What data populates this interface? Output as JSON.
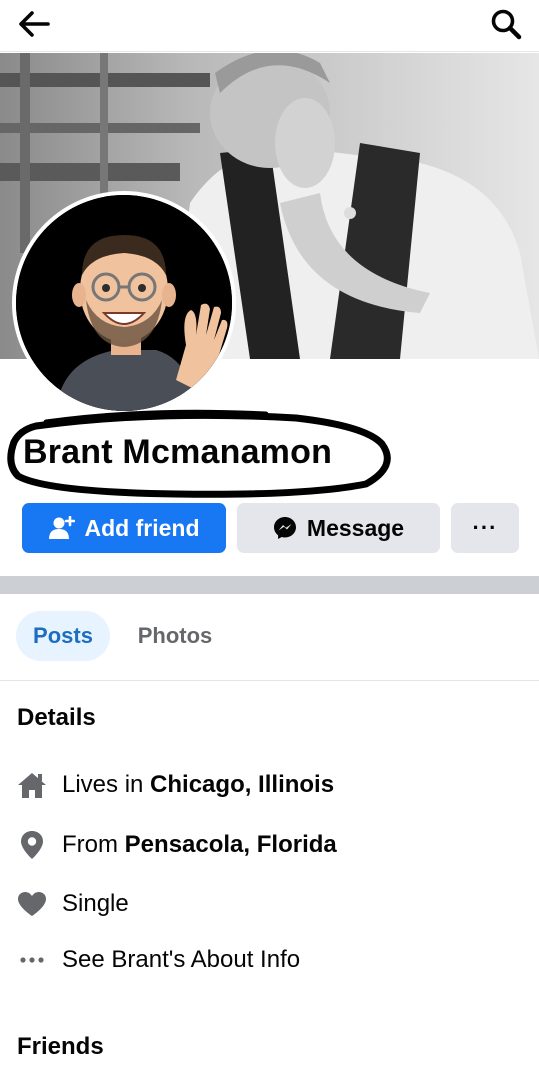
{
  "header": {
    "back_icon": "arrow-left-icon",
    "search_icon": "search-icon"
  },
  "profile": {
    "name": "Brant Mcmanamon",
    "cover_photo": "cover-photo",
    "avatar": "avatar-image"
  },
  "actions": {
    "add_friend_label": "Add friend",
    "message_label": "Message",
    "more_label": "···"
  },
  "tabs": [
    {
      "label": "Posts",
      "active": true
    },
    {
      "label": "Photos",
      "active": false
    }
  ],
  "details": {
    "title": "Details",
    "lives_prefix": "Lives in",
    "lives_value": "Chicago, Illinois",
    "from_prefix": "From",
    "from_value": "Pensacola, Florida",
    "relationship": "Single",
    "about_link": "See Brant's About Info"
  },
  "friends": {
    "title": "Friends"
  },
  "colors": {
    "primary": "#1877f2",
    "button_gray": "#e4e6eb",
    "tab_active_bg": "#e7f3ff",
    "icon_gray": "#65676b",
    "divider": "#ccd0d5"
  }
}
